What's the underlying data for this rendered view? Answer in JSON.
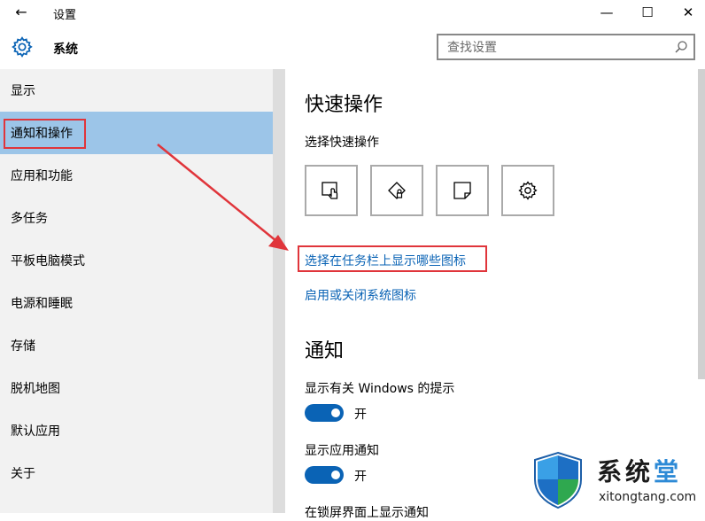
{
  "window": {
    "title": "设置",
    "back_glyph": "←",
    "min_glyph": "—",
    "max_glyph": "☐",
    "close_glyph": "✕"
  },
  "header": {
    "section_title": "系统",
    "search_placeholder": "查找设置"
  },
  "sidebar": {
    "items": [
      {
        "label": "显示"
      },
      {
        "label": "通知和操作",
        "active": true
      },
      {
        "label": "应用和功能"
      },
      {
        "label": "多任务"
      },
      {
        "label": "平板电脑模式"
      },
      {
        "label": "电源和睡眠"
      },
      {
        "label": "存储"
      },
      {
        "label": "脱机地图"
      },
      {
        "label": "默认应用"
      },
      {
        "label": "关于"
      }
    ]
  },
  "main": {
    "quick_actions_title": "快速操作",
    "quick_actions_subtitle": "选择快速操作",
    "quick_action_tiles": [
      {
        "icon": "tablet-mode-icon"
      },
      {
        "icon": "location-icon"
      },
      {
        "icon": "note-icon"
      },
      {
        "icon": "settings-gear-icon"
      }
    ],
    "link_taskbar_icons": "选择在任务栏上显示哪些图标",
    "link_system_icons": "启用或关闭系统图标",
    "notifications_title": "通知",
    "toggles": [
      {
        "label": "显示有关 Windows 的提示",
        "state_label": "开",
        "on": true
      },
      {
        "label": "显示应用通知",
        "state_label": "开",
        "on": true
      }
    ],
    "cut_label": "在锁屏界面上显示通知"
  },
  "watermark": {
    "brand_text_1": "系统",
    "brand_text_2": "堂",
    "url": "xitongtang.com"
  },
  "colors": {
    "accent": "#0a63b5",
    "sidebar_bg": "#f2f2f2",
    "active_item": "#9cc5e8",
    "highlight_red": "#e0353b"
  }
}
